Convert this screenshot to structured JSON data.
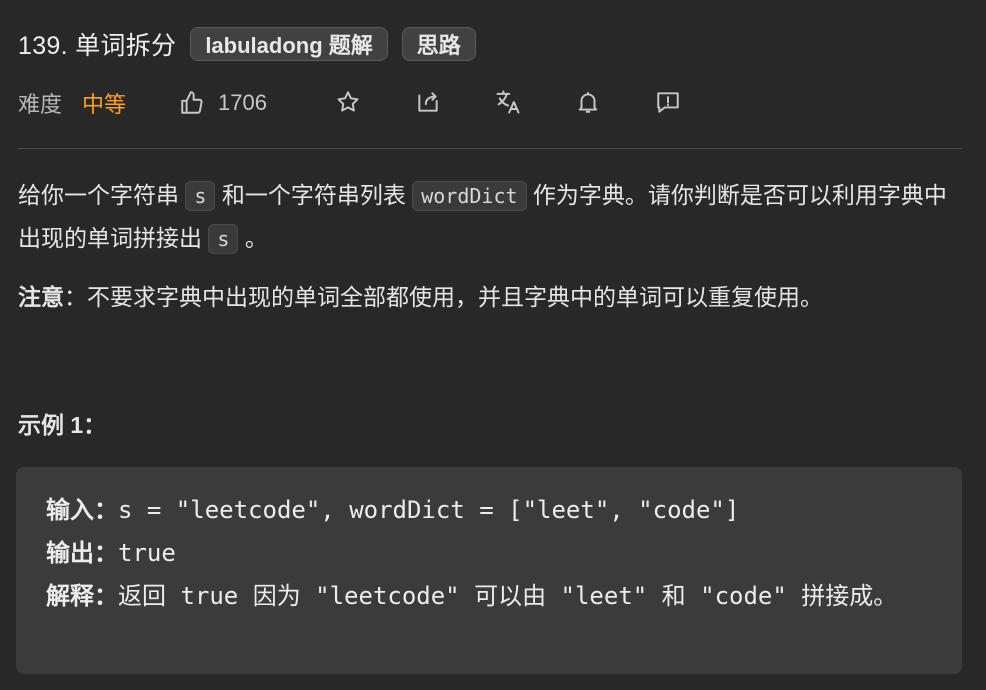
{
  "header": {
    "title": "139. 单词拆分",
    "tags": [
      "labuladong 题解",
      "思路"
    ]
  },
  "meta": {
    "difficulty_label": "难度",
    "difficulty": "中等",
    "difficulty_color": "#ffa116",
    "likes": "1706",
    "icons": [
      "thumbs-up-icon",
      "star-icon",
      "share-icon",
      "translate-icon",
      "bell-icon",
      "feedback-icon"
    ]
  },
  "description": {
    "p1_a": "给你一个字符串 ",
    "p1_code1": "s",
    "p1_b": " 和一个字符串列表 ",
    "p1_code2": "wordDict",
    "p1_c": " 作为字典。请你判断是否可以利用字典中出现的单词拼接出 ",
    "p1_code3": "s",
    "p1_d": " 。",
    "note_label": "注意",
    "note_text": "：不要求字典中出现的单词全部都使用，并且字典中的单词可以重复使用。"
  },
  "example": {
    "title": "示例 1：",
    "input_label": "输入：",
    "input_value": "s = \"leetcode\", wordDict = [\"leet\", \"code\"]",
    "output_label": "输出：",
    "output_value": "true",
    "explain_label": "解释：",
    "explain_value": "返回 true 因为 \"leetcode\" 可以由 \"leet\" 和 \"code\" 拼接成。"
  }
}
